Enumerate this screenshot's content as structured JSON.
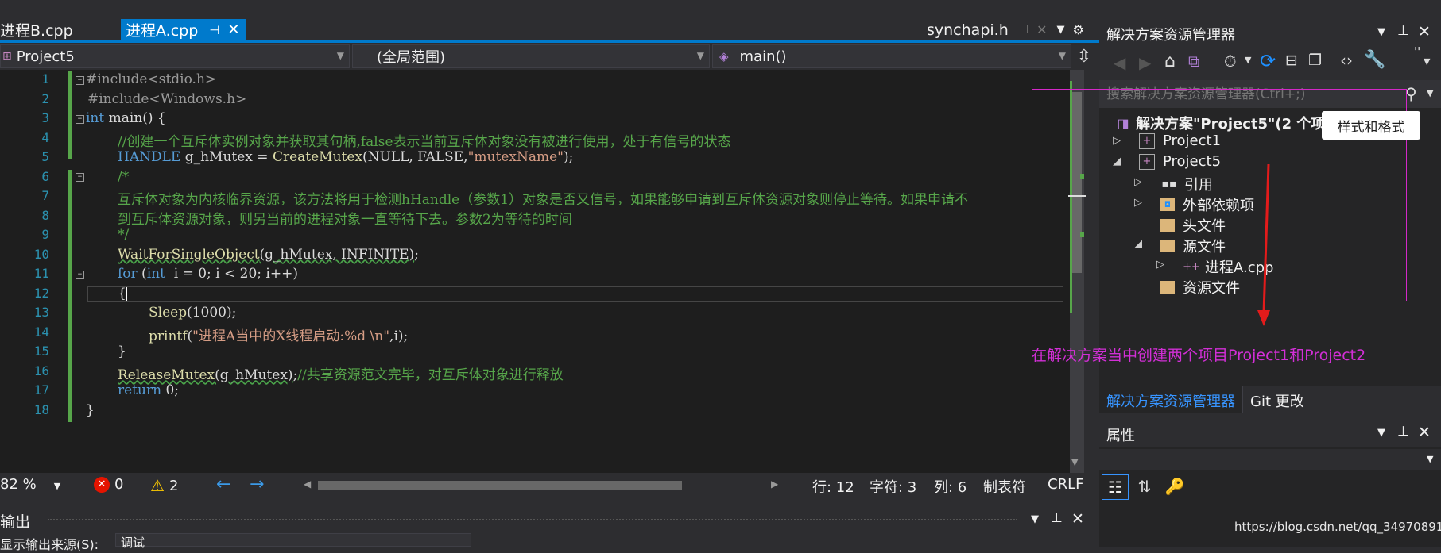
{
  "tabs": [
    {
      "label": "进程B.cpp",
      "active": false
    },
    {
      "label": "进程A.cpp",
      "active": true
    },
    {
      "label": "synchapi.h",
      "active": false
    }
  ],
  "nav": {
    "project": "Project5",
    "scope": "(全局范围)",
    "member": "main()"
  },
  "code": {
    "line_numbers": [
      "1",
      "2",
      "3",
      "4",
      "5",
      "6",
      "7",
      "8",
      "9",
      "10",
      "11",
      "12",
      "13",
      "14",
      "15",
      "16",
      "17",
      "18"
    ],
    "l1": "#include<stdio.h>",
    "l2": "#include<Windows.h>",
    "l3_kw": "int",
    "l3_rest": " main() {",
    "l4": "//创建一个互斥体实例对象并获取其句柄,false表示当前互斥体对象没有被进行使用，处于有信号的状态",
    "l5_a": "HANDLE",
    "l5_b": "g_hMutex",
    "l5_c": " = ",
    "l5_d": "CreateMutex",
    "l5_e": "(NULL, FALSE,",
    "l5_f": "\"mutexName\"",
    "l5_g": ");",
    "l6": "/*",
    "l7": "互斥体对象为内核临界资源，该方法将用于检测hHandle（参数1）对象是否又信号，如果能够申请到互斥体资源对象则停止等待。如果申请不",
    "l8": "到互斥体资源对象，则另当前的进程对象一直等待下去。参数2为等待的时间",
    "l9": "*/",
    "l10_a": "WaitForSingleObject",
    "l10_b": "(g_hMutex, INFINITE)",
    "l10_c": ";",
    "l11_a": "for",
    "l11_b": " (",
    "l11_c": "int",
    "l11_d": "  i = 0; i < 20; i++)",
    "l12": "{",
    "l13_a": "Sleep",
    "l13_b": "(1000);",
    "l14_a": "printf",
    "l14_b": "(",
    "l14_c": "\"进程A当中的X线程启动:%d \\n\"",
    "l14_d": ",i);",
    "l15": "}",
    "l16_a": "ReleaseMutex",
    "l16_b": "(g_hMutex)",
    "l16_c": ";",
    "l16_d": "//共享资源范文完毕，对互斥体对象进行释放",
    "l17_a": "return",
    "l17_b": " 0;",
    "l18": "}"
  },
  "status": {
    "zoom": "82 %",
    "errors": "0",
    "warnings": "2",
    "line": "行: 12",
    "char": "字符: 3",
    "col": "列: 6",
    "tabs": "制表符",
    "eol": "CRLF"
  },
  "output": {
    "title": "输出",
    "source_label": "显示输出来源(S):",
    "source_value": "调试"
  },
  "solution_explorer": {
    "title": "解决方案资源管理器",
    "search_placeholder": "搜索解决方案资源管理器(Ctrl+;)",
    "root": "解决方案\"Project5\"(2 个项目",
    "project1": "Project1",
    "project5": "Project5",
    "references": "引用",
    "external_deps": "外部依赖项",
    "headers": "头文件",
    "sources": "源文件",
    "file_a": "进程A.cpp",
    "resources": "资源文件",
    "tab_se": "解决方案资源管理器",
    "tab_git": "Git 更改"
  },
  "properties": {
    "title": "属性"
  },
  "tooltip": "样式和格式",
  "annotation": "在解决方案当中创建两个项目Project1和Project2",
  "watermark": "https://blog.csdn.net/qq_34970891",
  "colors": {
    "accent": "#007acc",
    "annotation": "#d22fd6",
    "code_comment": "#57a64a",
    "keyword": "#569cd6"
  }
}
